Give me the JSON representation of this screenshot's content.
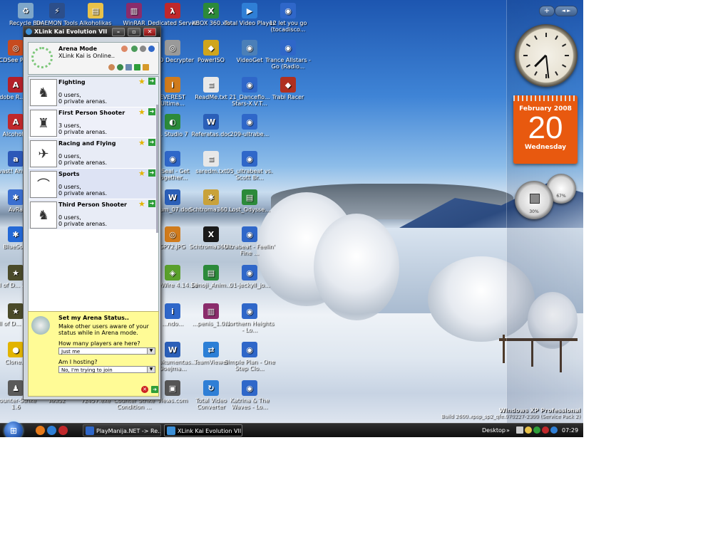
{
  "desktop": {
    "icons": [
      {
        "label": "Recycle Bin",
        "color": "#7fa7c9",
        "glyph": "♻"
      },
      {
        "label": "DAEMON Tools",
        "color": "#2c4e8a",
        "glyph": "⚡"
      },
      {
        "label": "Alkoholikas",
        "color": "#e8c24a",
        "glyph": "▤"
      },
      {
        "label": "WinRAR",
        "color": "#8a2c6b",
        "glyph": "▥"
      },
      {
        "label": "Dedicated Server",
        "color": "#c0282b",
        "glyph": "λ"
      },
      {
        "label": "XBOX 360.xls",
        "color": "#2c8a3a",
        "glyph": "X"
      },
      {
        "label": "Total Video Player",
        "color": "#2f7fd6",
        "glyph": "▶"
      },
      {
        "label": "12 let you go (tocadisco...",
        "color": "#2f67c9",
        "glyph": "◉"
      },
      {
        "label": "ACDSee Photo",
        "color": "#c74b1f",
        "glyph": "◎"
      },
      {
        "label": "Adobe R... 6.0",
        "color": "#b3202a",
        "glyph": "A"
      },
      {
        "label": "Alcohol 1",
        "color": "#c0282b",
        "glyph": "A"
      },
      {
        "label": "avast! Antivi...",
        "color": "#2c58b8",
        "glyph": "a"
      },
      {
        "label": "AvRa",
        "color": "#3b6fd0",
        "glyph": "✱"
      },
      {
        "label": "BlueSo...",
        "color": "#2469d6",
        "glyph": "✱"
      },
      {
        "label": "Call of D... 2 Multi",
        "color": "#4b4b2a",
        "glyph": "★"
      },
      {
        "label": "Call of D... Single",
        "color": "#4b4b2a",
        "glyph": "★"
      },
      {
        "label": "Clone...",
        "color": "#e2b400",
        "glyph": "●"
      },
      {
        "label": "Counter-Strike 1.6",
        "color": "#5a5a5a",
        "glyph": "♟"
      },
      {
        "label": "AKIS2",
        "color": "#6a6a6a",
        "glyph": "▣"
      },
      {
        "label": "7z457.exe",
        "color": "#6a6a6a",
        "glyph": "▣"
      },
      {
        "label": "Counter Strike Condition ...",
        "color": "#6a6a6a",
        "glyph": "▣"
      },
      {
        "label": "DVD Decrypter",
        "color": "#9a9a9a",
        "glyph": "◎"
      },
      {
        "label": "PowerISO",
        "color": "#d0a51c",
        "glyph": "◆"
      },
      {
        "label": "VideoGet",
        "color": "#4b7fb8",
        "glyph": "◉"
      },
      {
        "label": "Trance Allstars - Go (Radio...",
        "color": "#2f67c9",
        "glyph": "◉"
      },
      {
        "label": "EVEREST Ultima...",
        "color": "#d07b1c",
        "glyph": "i"
      },
      {
        "label": "ReadMe.txt",
        "color": "#e8e8e8",
        "glyph": "≡"
      },
      {
        "label": "21_Danceflo... Stars-X.V.T...",
        "color": "#2f67c9",
        "glyph": "◉"
      },
      {
        "label": "Trabi Racer",
        "color": "#b03020",
        "glyph": "◆"
      },
      {
        "label": "... Studio 7",
        "color": "#2c8a3a",
        "glyph": "◐"
      },
      {
        "label": "Referatas.doc",
        "color": "#2b5fb8",
        "glyph": "W"
      },
      {
        "label": "209-ultrabe...",
        "color": "#2f67c9",
        "glyph": "◉"
      },
      {
        "label": "7 Seal - Get Together...",
        "color": "#2f67c9",
        "glyph": "◉"
      },
      {
        "label": "saredm.txt",
        "color": "#e8e8e8",
        "glyph": "≡"
      },
      {
        "label": "05_ultrabeat vs. Scott Br...",
        "color": "#2f67c9",
        "glyph": "◉"
      },
      {
        "label": "...um_07.doc",
        "color": "#2b5fb8",
        "glyph": "W"
      },
      {
        "label": "Schtroma360...",
        "color": "#c9a23a",
        "glyph": "✱"
      },
      {
        "label": "Lost_Odysse...",
        "color": "#2c8a3a",
        "glyph": "▤"
      },
      {
        "label": "SP72.JPG",
        "color": "#d07b1c",
        "glyph": "◎"
      },
      {
        "label": "Schtroma360...",
        "color": "#1a1a1a",
        "glyph": "X"
      },
      {
        "label": "Ultrabeat - Feelin' Fine ...",
        "color": "#2f67c9",
        "glyph": "◉"
      },
      {
        "label": "LimeWire 4.14.10",
        "color": "#5aa02c",
        "glyph": "◈"
      },
      {
        "label": "Senoji_Anim...",
        "color": "#2c8a3a",
        "glyph": "▤"
      },
      {
        "label": "01-jeckyll_jo...",
        "color": "#2f67c9",
        "glyph": "◉"
      },
      {
        "label": "...ndo...",
        "color": "#2f67c9",
        "glyph": "i"
      },
      {
        "label": "...penis_1.0...",
        "color": "#8a2c6b",
        "glyph": "▥"
      },
      {
        "label": "Northern Heights - Lo...",
        "color": "#2f67c9",
        "glyph": "◉"
      },
      {
        "label": "...Dokumentas... Doejma...",
        "color": "#2b5fb8",
        "glyph": "W"
      },
      {
        "label": "TeamViewer",
        "color": "#2c7fd6",
        "glyph": "⇄"
      },
      {
        "label": "Simple Plan - One Step Clo...",
        "color": "#2f67c9",
        "glyph": "◉"
      },
      {
        "label": "views.com",
        "color": "#555555",
        "glyph": "▣"
      },
      {
        "label": "Total Video Converter",
        "color": "#2f7fd6",
        "glyph": "↻"
      },
      {
        "label": "Katrina & The Waves - Lo...",
        "color": "#2f67c9",
        "glyph": "◉"
      }
    ],
    "watermark": {
      "line1": "Windows XP Professional",
      "line2": "Build 2600.xpsp_sp2_qfe.070227-2300 (Service Pack 2)"
    }
  },
  "sidebar": {
    "add_label": "+",
    "nav_label": "◄ ►",
    "calendar": {
      "month": "February 2008",
      "day": "20",
      "weekday": "Wednesday"
    },
    "clock_time": "07:29",
    "gauge_cpu": "30%",
    "gauge_mem": "67%"
  },
  "taskbar": {
    "start_glyph": "⊞",
    "tasks": [
      {
        "label": "PlayManija.NET -> Re...",
        "active": false
      },
      {
        "label": "XLink Kai Evolution VII",
        "active": true
      }
    ],
    "desktop_label": "Desktop",
    "chevron": "»",
    "time": "07:29"
  },
  "xlink": {
    "title": "XLink Kai Evolution VII",
    "minimize": "–",
    "restore": "▫",
    "close": "✕",
    "mode_title": "Arena Mode",
    "status": "XLink Kai is Online..",
    "arenas": [
      {
        "name": "Fighting",
        "users": "0 users,",
        "private": "0 private arenas.",
        "thumb": "♞"
      },
      {
        "name": "First Person Shooter",
        "users": "3 users,",
        "private": "0 private arenas.",
        "thumb": "♜"
      },
      {
        "name": "Racing and Flying",
        "users": "0 users,",
        "private": "0 private arenas.",
        "thumb": "✈"
      },
      {
        "name": "Sports",
        "users": "0 users,",
        "private": "0 private arenas.",
        "thumb": "⌒"
      },
      {
        "name": "Third Person Shooter",
        "users": "0 users,",
        "private": "0 private arenas.",
        "thumb": "♞"
      }
    ],
    "status_panel": {
      "title": "Set my Arena Status..",
      "description": "Make other users aware of your status while in Arena mode.",
      "q1": "How many players are here?",
      "a1": "Just me",
      "q2": "Am I hosting?",
      "a2": "No, I'm trying to join"
    }
  }
}
